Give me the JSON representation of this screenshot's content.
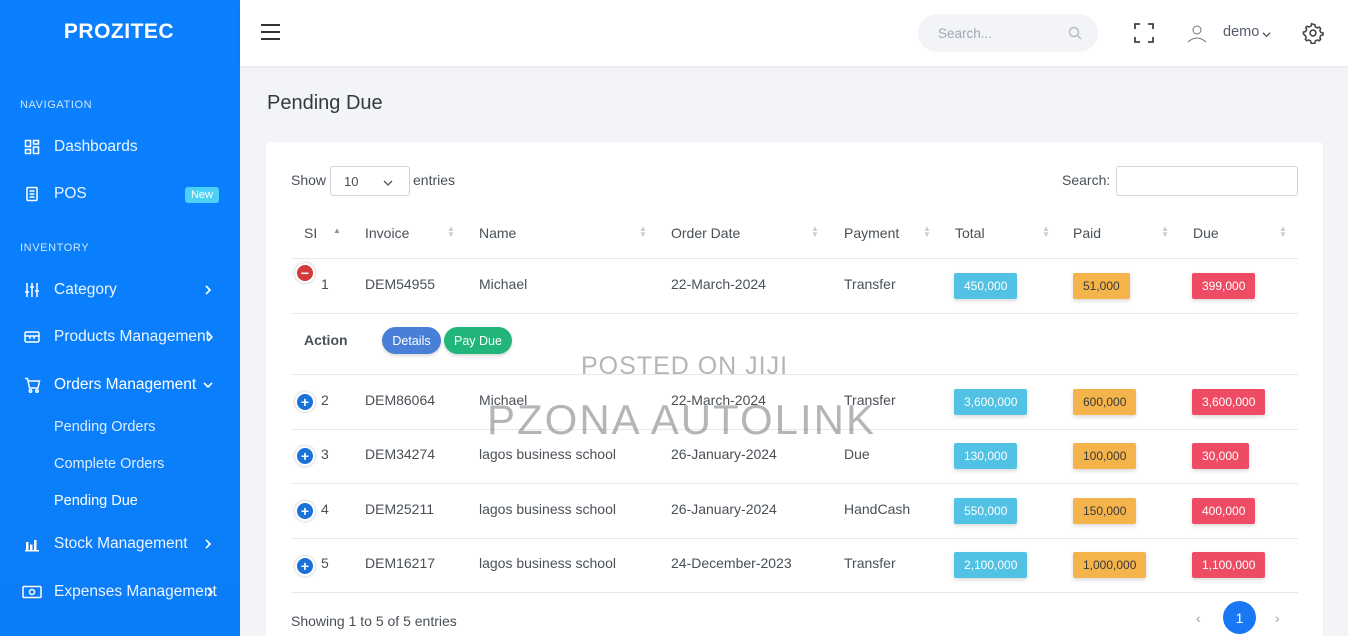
{
  "brand": "PROZITEC",
  "sidebar": {
    "sections": [
      "NAVIGATION",
      "INVENTORY"
    ],
    "items": [
      {
        "label": "Dashboards",
        "icon": "dashboard-icon"
      },
      {
        "label": "POS",
        "icon": "pos-icon",
        "badge": "New"
      },
      {
        "label": "Category",
        "icon": "sliders-icon"
      },
      {
        "label": "Products Management",
        "icon": "box-icon"
      },
      {
        "label": "Orders Management",
        "icon": "cart-icon"
      },
      {
        "label": "Stock Management",
        "icon": "bar-chart-icon"
      },
      {
        "label": "Expenses Management",
        "icon": "money-icon"
      }
    ],
    "orders_sub": [
      "Pending Orders",
      "Complete Orders",
      "Pending Due"
    ]
  },
  "topbar": {
    "search_placeholder": "Search...",
    "user": "demo"
  },
  "page": {
    "title": "Pending Due"
  },
  "table": {
    "show_label": "Show",
    "page_length": "10",
    "entries_label": "entries",
    "search_label": "Search:",
    "headers": [
      "SI",
      "Invoice",
      "Name",
      "Order Date",
      "Payment",
      "Total",
      "Paid",
      "Due"
    ],
    "rows": [
      {
        "si": "1",
        "invoice": "DEM54955",
        "name": "Michael",
        "date": "22-March-2024",
        "payment": "Transfer",
        "total": "450,000",
        "paid": "51,000",
        "due": "399,000"
      },
      {
        "si": "2",
        "invoice": "DEM86064",
        "name": "Michael",
        "date": "22-March-2024",
        "payment": "Transfer",
        "total": "3,600,000",
        "paid": "600,000",
        "due": "3,600,000"
      },
      {
        "si": "3",
        "invoice": "DEM34274",
        "name": "lagos business school",
        "date": "26-January-2024",
        "payment": "Due",
        "total": "130,000",
        "paid": "100,000",
        "due": "30,000"
      },
      {
        "si": "4",
        "invoice": "DEM25211",
        "name": "lagos business school",
        "date": "26-January-2024",
        "payment": "HandCash",
        "total": "550,000",
        "paid": "150,000",
        "due": "400,000"
      },
      {
        "si": "5",
        "invoice": "DEM16217",
        "name": "lagos business school",
        "date": "24-December-2023",
        "payment": "Transfer",
        "total": "2,100,000",
        "paid": "1,000,000",
        "due": "1,100,000"
      }
    ],
    "child_row": {
      "label": "Action",
      "details": "Details",
      "pay_due": "Pay Due"
    },
    "info": "Showing 1 to 5 of 5 entries",
    "current_page": "1",
    "prev": "‹",
    "next": "›"
  },
  "watermark": {
    "line1": "POSTED ON JIJI",
    "line2": "PZONA AUTOLINK"
  },
  "colors": {
    "sidebar": "#0a84ff",
    "total": "#51c2e3",
    "paid": "#f5b34b",
    "due": "#ee4c65",
    "details": "#4a7fd8",
    "pay_due": "#22b57a"
  }
}
